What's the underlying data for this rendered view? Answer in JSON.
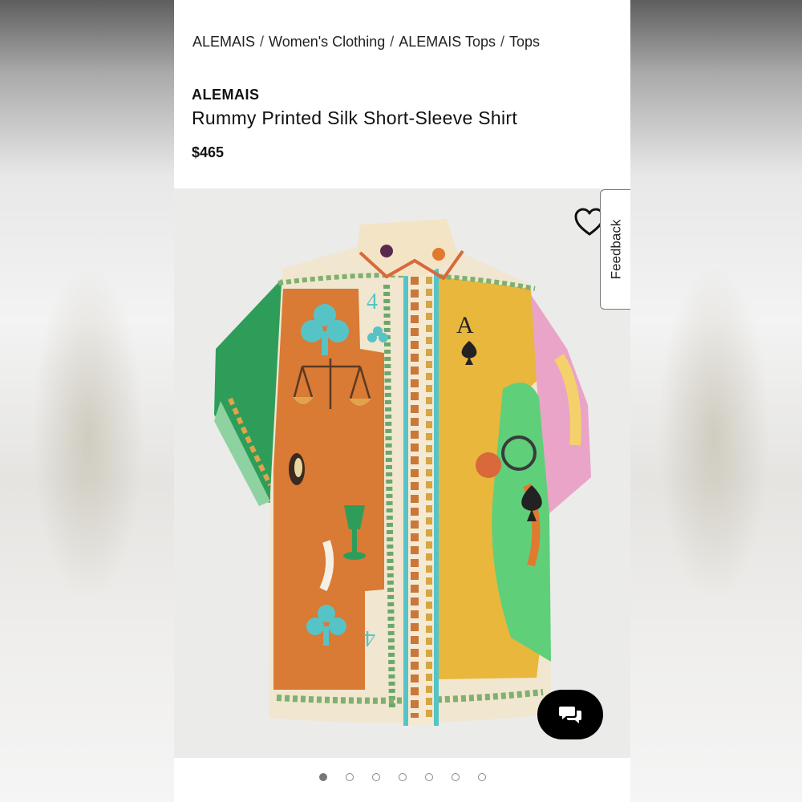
{
  "breadcrumb": {
    "items": [
      "ALEMAIS",
      "Women's Clothing",
      "ALEMAIS Tops",
      "Tops"
    ],
    "separator": "/"
  },
  "product": {
    "brand": "ALEMAIS",
    "title": "Rummy Printed Silk Short-Sleeve Shirt",
    "price": "$465"
  },
  "gallery": {
    "shirt_print_text": {
      "ace": "A",
      "four": "4"
    },
    "wishlist_icon": "heart-icon",
    "chat_icon": "chat-bubbles-icon",
    "dot_count": 7,
    "active_dot_index": 0
  },
  "feedback": {
    "label": "Feedback"
  },
  "colors": {
    "orange_panel": "#d97a35",
    "yellow_panel": "#e8b73c",
    "green_sleeve": "#2f9d5a",
    "pink_sleeve": "#e9a4c8",
    "teal_motif": "#56c4c7",
    "background": "#ebebea"
  }
}
